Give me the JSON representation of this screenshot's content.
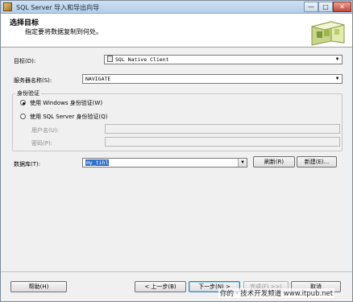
{
  "window": {
    "title": "SQL Server 导入和导出向导",
    "min_glyph": "—",
    "max_glyph": "□",
    "close_glyph": "✕"
  },
  "header": {
    "title": "选择目标",
    "subtitle": "指定要将数据复制到何处。"
  },
  "form": {
    "destination_label": "目标(D):",
    "destination_value": "SQL Native Client",
    "server_label": "服务器名称(S):",
    "server_value": "NAVIGATE",
    "auth_group_label": "身份验证",
    "auth_windows_label": "使用 Windows 身份验证(W)",
    "auth_sql_label": "使用 SQL Server 身份验证(Q)",
    "auth_selected": "windows",
    "username_label": "用户名(U):",
    "password_label": "密码(P):",
    "database_label": "数据库(T):",
    "database_value": "my_tihl",
    "refresh_label": "刷新(R)",
    "new_label": "新建(E)..."
  },
  "footer": {
    "help_label": "帮助(H)",
    "back_label": "< 上一步(B)",
    "next_label": "下一步(N) >",
    "finish_label": "完成(F) >>|",
    "cancel_label": "取消"
  },
  "watermark": "你的 · 技术开发频道 www.itpub.net",
  "icons": {
    "dropdown": "chevron-down-icon",
    "window_app": "sql-server-app-icon",
    "header_art": "database-export-graphic"
  },
  "colors": {
    "selection": "#3170c7",
    "title_bar": "#b3cde9",
    "header_bg": "#ffffff"
  }
}
